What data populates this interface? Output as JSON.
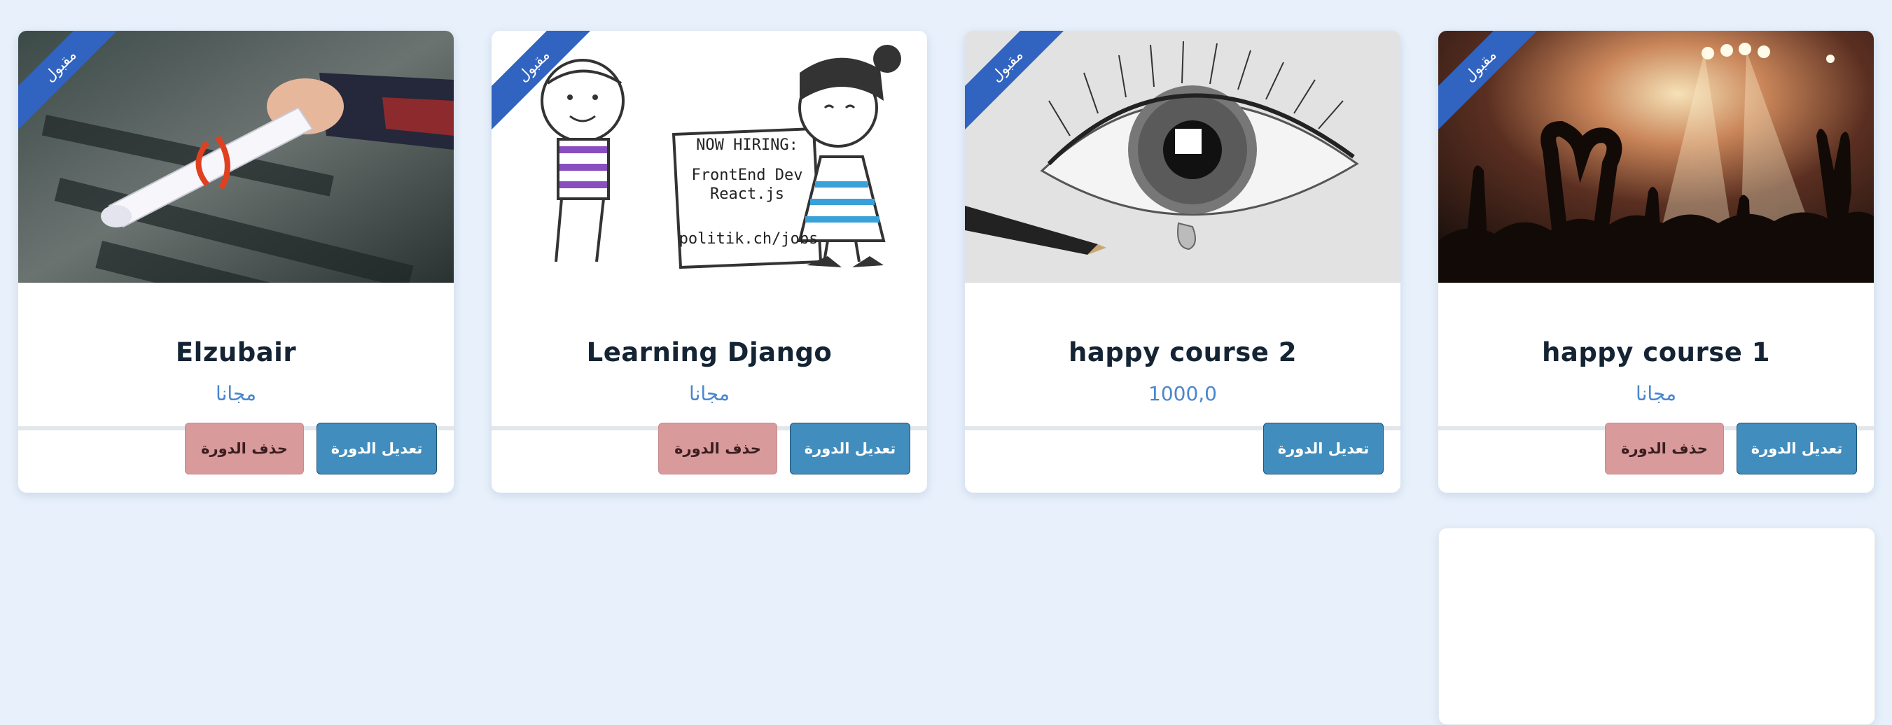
{
  "ribbon_label": "مقبول",
  "courses": [
    {
      "title": "happy course 1",
      "price": "مجانا",
      "edit_label": "تعديل الدورة",
      "delete_label": "حذف الدورة",
      "has_delete": true
    },
    {
      "title": "happy course 2",
      "price": "1000,0",
      "edit_label": "تعديل الدورة",
      "has_delete": false
    },
    {
      "title": "Learning Django",
      "price": "مجانا",
      "edit_label": "تعديل الدورة",
      "delete_label": "حذف الدورة",
      "has_delete": true,
      "image_text": [
        "NOW HIRING:",
        "FrontEnd Dev",
        "React.js",
        "politik.ch/jobs"
      ]
    },
    {
      "title": "Elzubair",
      "price": "مجانا",
      "edit_label": "تعديل الدورة",
      "delete_label": "حذف الدورة",
      "has_delete": true
    }
  ],
  "colors": {
    "background": "#e8f1fb",
    "ribbon": "#3163c0",
    "edit_button": "#418dbd",
    "delete_button": "#d99a9c",
    "price": "#4a86cf"
  }
}
